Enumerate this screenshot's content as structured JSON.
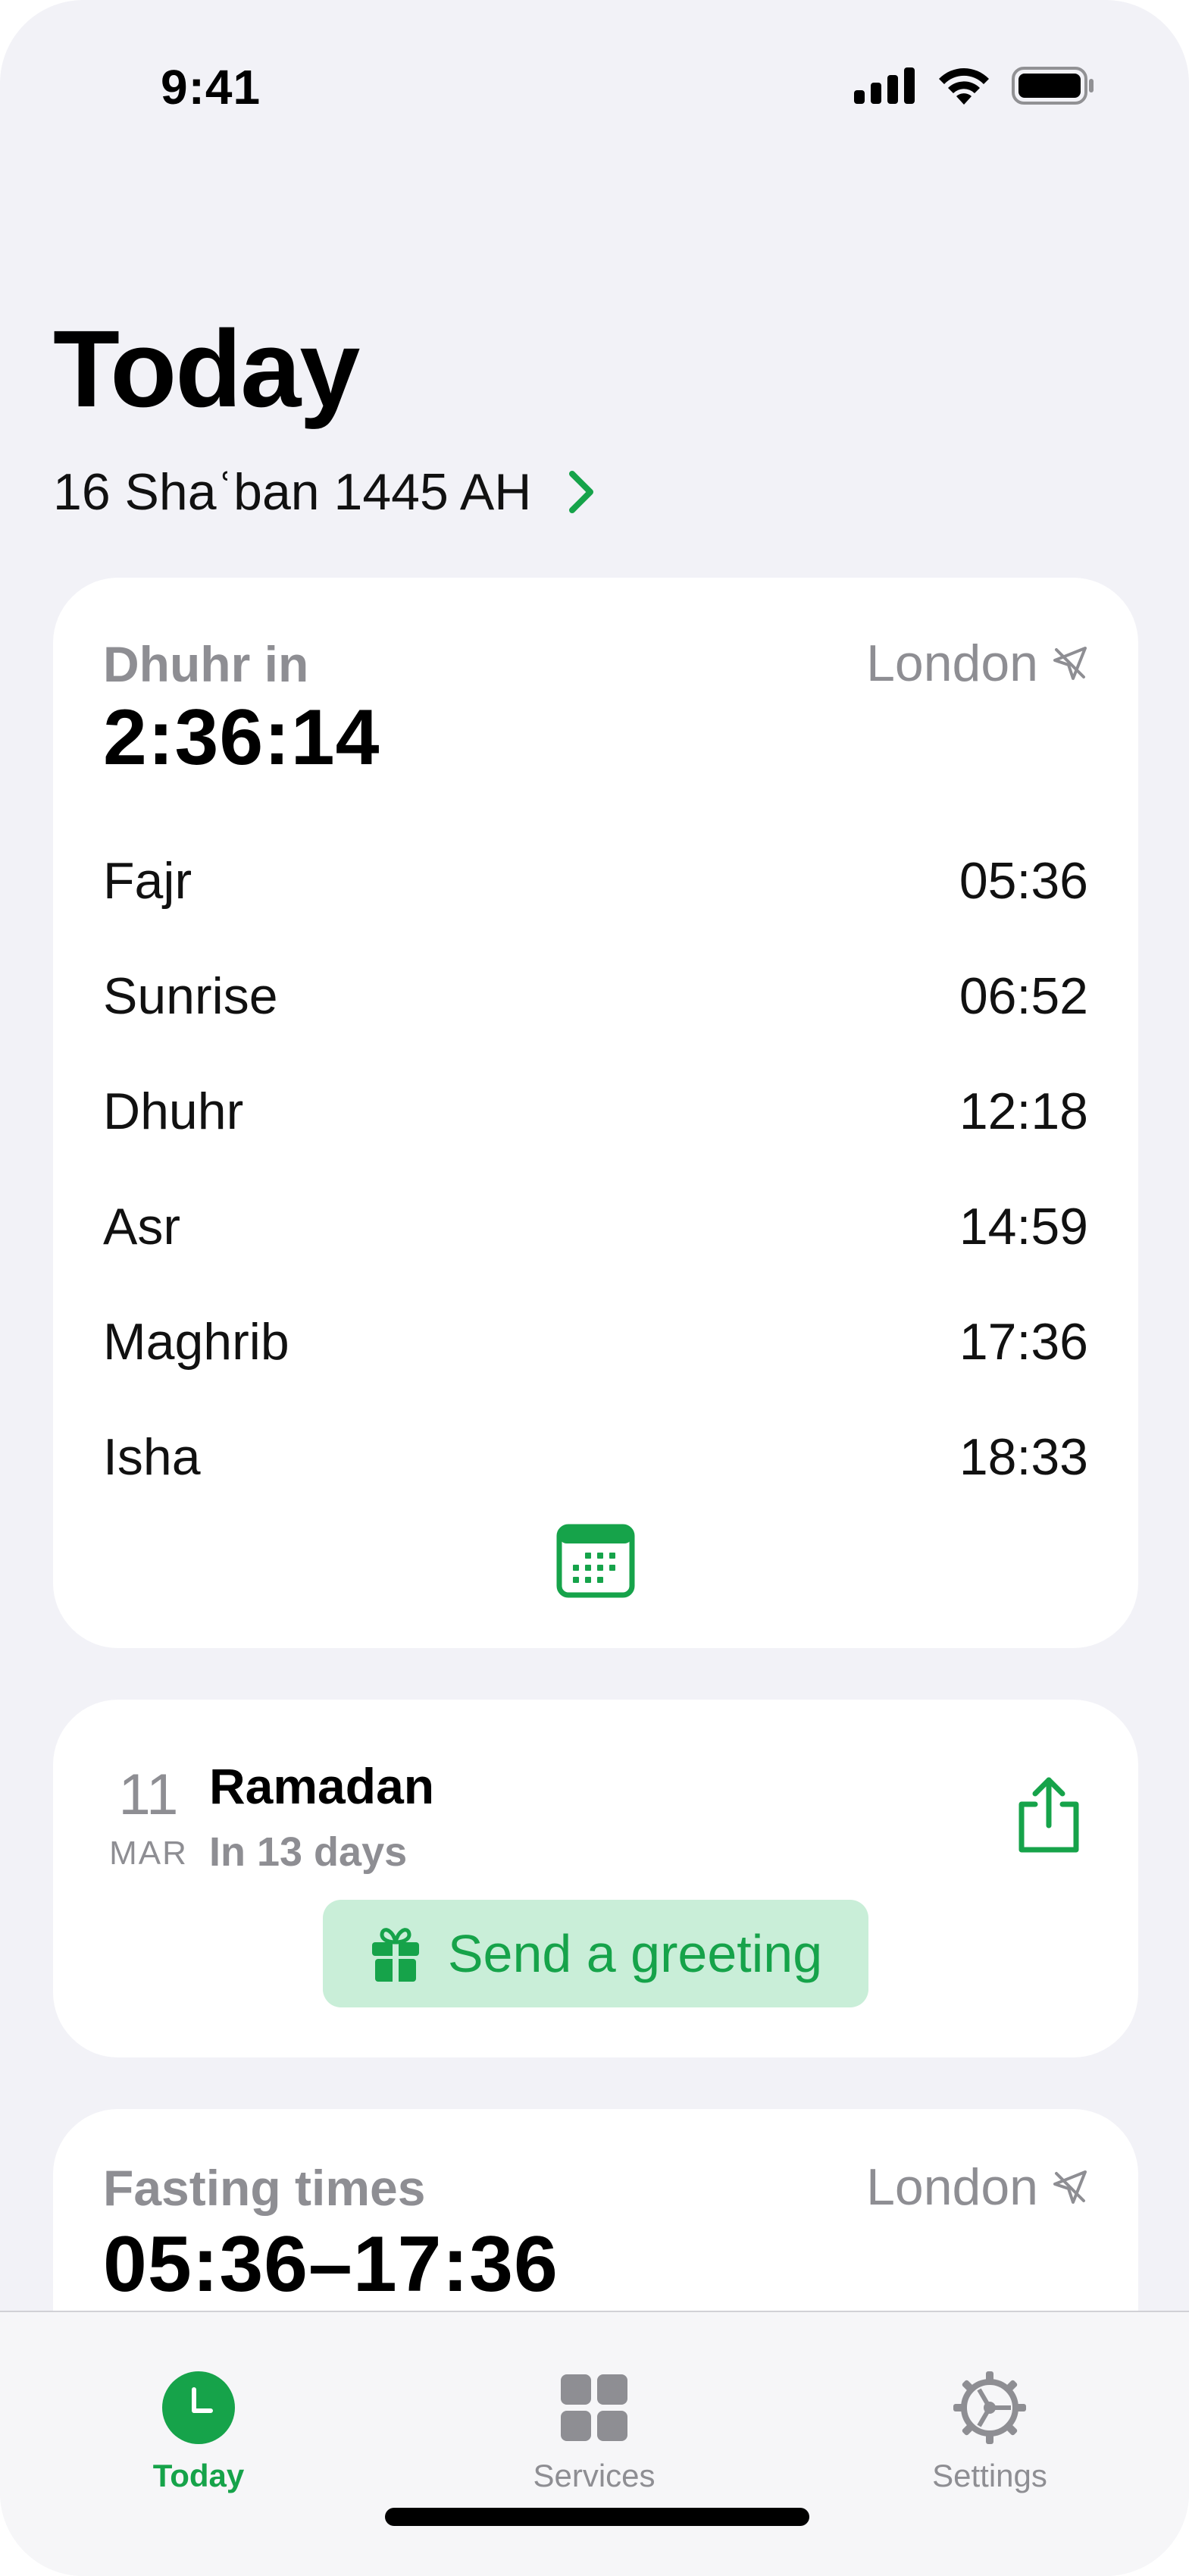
{
  "status_bar": {
    "time": "9:41"
  },
  "header": {
    "title": "Today",
    "hijri_date": "16 Shaʿban 1445 AH"
  },
  "prayer_card": {
    "countdown_label": "Dhuhr in",
    "countdown": "2:36:14",
    "location": "London",
    "prayers": [
      {
        "name": "Fajr",
        "time": "05:36"
      },
      {
        "name": "Sunrise",
        "time": "06:52"
      },
      {
        "name": "Dhuhr",
        "time": "12:18"
      },
      {
        "name": "Asr",
        "time": "14:59"
      },
      {
        "name": "Maghrib",
        "time": "17:36"
      },
      {
        "name": "Isha",
        "time": "18:33"
      }
    ]
  },
  "event_card": {
    "day": "11",
    "month": "MAR",
    "title": "Ramadan",
    "subtitle": "In 13 days",
    "greeting_button": "Send a greeting"
  },
  "fasting_card": {
    "label": "Fasting times",
    "times": "05:36–17:36",
    "location": "London"
  },
  "tabs": [
    {
      "label": "Today",
      "active": true
    },
    {
      "label": "Services",
      "active": false
    },
    {
      "label": "Settings",
      "active": false
    }
  ],
  "colors": {
    "accent": "#16a34a",
    "secondary_text": "#8e8e93",
    "background": "#f2f2f7",
    "button_fill": "#c9eed8"
  },
  "icons": [
    "signal-icon",
    "wifi-icon",
    "battery-icon",
    "chevron-right-icon",
    "location-arrow-icon",
    "calendar-icon",
    "share-icon",
    "gift-icon",
    "clock-icon",
    "grid-icon",
    "gear-icon"
  ]
}
